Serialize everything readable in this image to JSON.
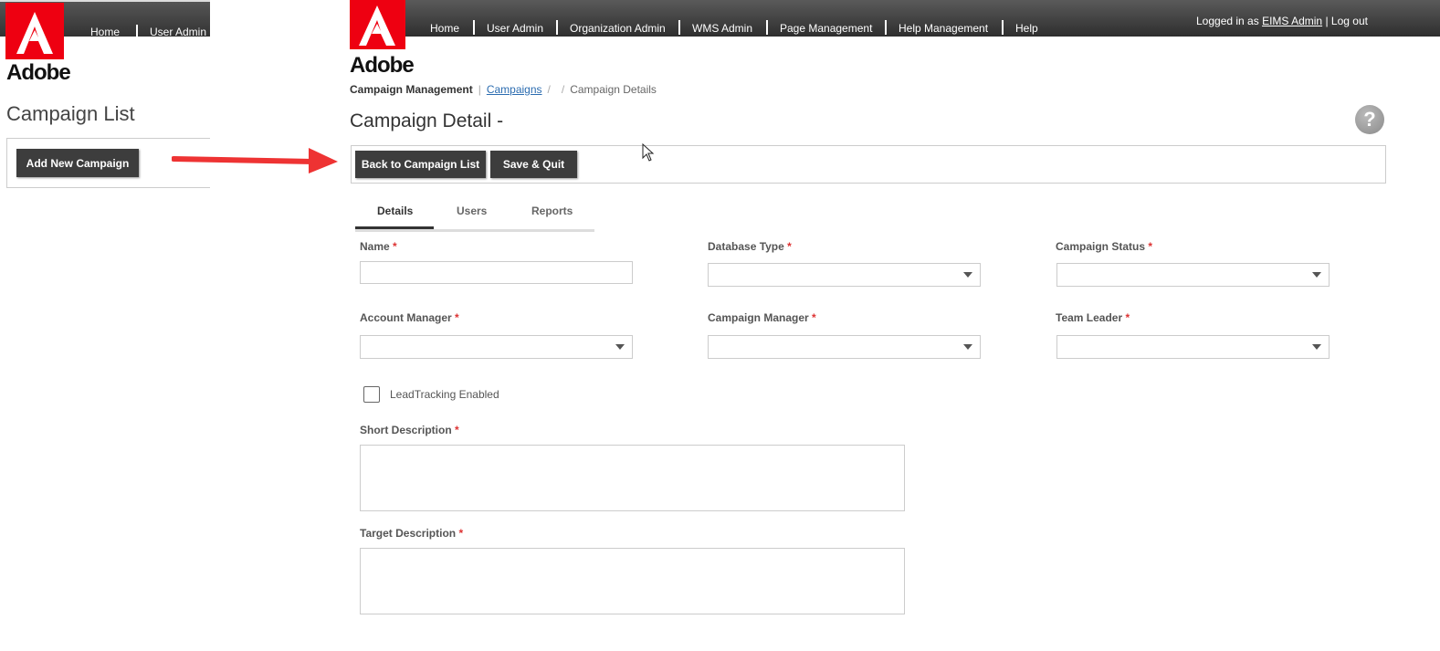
{
  "brand": {
    "name": "Adobe",
    "logo_color": "#ee1111"
  },
  "left_panel": {
    "nav": [
      "Home",
      "User Admin"
    ],
    "title": "Campaign List",
    "add_button": "Add New Campaign"
  },
  "nav": {
    "items": [
      "Home",
      "User Admin",
      "Organization Admin",
      "WMS Admin",
      "Page Management",
      "Help Management",
      "Help"
    ],
    "logged_in_prefix": "Logged in as",
    "user": "EIMS Admin",
    "separator": "|",
    "logout": "Log out"
  },
  "breadcrumb": {
    "root": "Campaign Management",
    "campaigns": "Campaigns",
    "current": "Campaign Details"
  },
  "page": {
    "title": "Campaign Detail -",
    "help_icon": "question-icon"
  },
  "toolbar": {
    "back_label": "Back to Campaign List",
    "save_label": "Save & Quit"
  },
  "tabs": [
    "Details",
    "Users",
    "Reports"
  ],
  "active_tab": "Details",
  "form": {
    "name_label": "Name",
    "database_type_label": "Database Type",
    "campaign_status_label": "Campaign Status",
    "account_manager_label": "Account Manager",
    "campaign_manager_label": "Campaign Manager",
    "team_leader_label": "Team Leader",
    "lead_tracking_label": "LeadTracking Enabled",
    "short_description_label": "Short Description",
    "target_description_label": "Target Description",
    "required_mark": "*"
  }
}
